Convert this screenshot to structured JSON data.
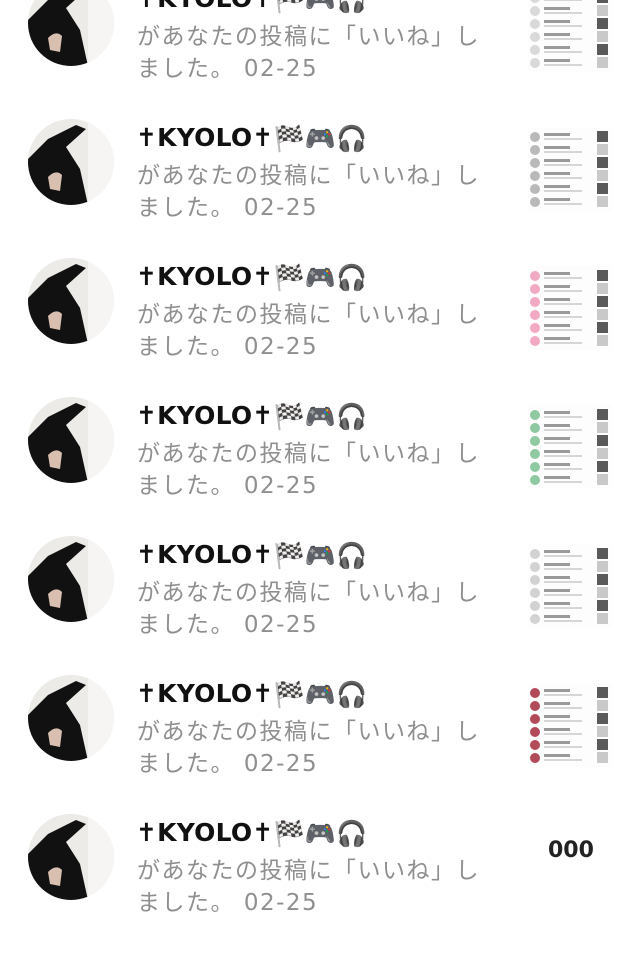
{
  "notifications": [
    {
      "user": "✝KYOLO✝",
      "message": "があなたの投稿に「いいね」しました。",
      "date": "02-25",
      "thumb_accent": "#d9d9d9"
    },
    {
      "user": "✝KYOLO✝",
      "message": "があなたの投稿に「いいね」しました。",
      "date": "02-25",
      "thumb_accent": "#b9b9b9"
    },
    {
      "user": "✝KYOLO✝",
      "message": "があなたの投稿に「いいね」しました。",
      "date": "02-25",
      "thumb_accent": "#f2a9c4"
    },
    {
      "user": "✝KYOLO✝",
      "message": "があなたの投稿に「いいね」しました。",
      "date": "02-25",
      "thumb_accent": "#8fc9a1"
    },
    {
      "user": "✝KYOLO✝",
      "message": "があなたの投稿に「いいね」しました。",
      "date": "02-25",
      "thumb_accent": "#d2d2d2"
    },
    {
      "user": "✝KYOLO✝",
      "message": "があなたの投稿に「いいね」しました。",
      "date": "02-25",
      "thumb_accent": "#b34a5a"
    },
    {
      "user": "✝KYOLO✝",
      "message": "があなたの投稿に「いいね」しました。",
      "date": "02-25",
      "thumb_accent": "#cccccc"
    }
  ],
  "name_emojis": [
    "🏁",
    "🎮",
    "🎧"
  ],
  "partial_text": "000",
  "colors": {
    "name_text": "#111111",
    "message_text": "#8f8f8f",
    "background": "#ffffff"
  }
}
